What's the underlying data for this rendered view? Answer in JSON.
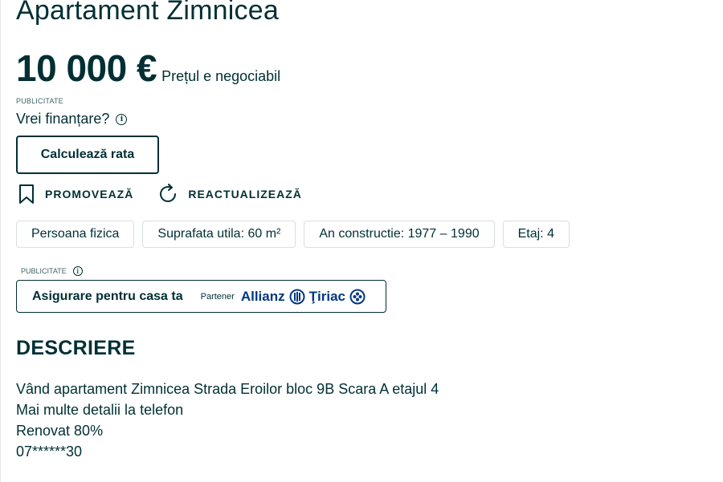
{
  "listing": {
    "title": "Apartament Zimnicea",
    "price": "10 000 €",
    "negotiable": "Prețul e negociabil"
  },
  "financing": {
    "ad_label": "PUBLICITATE",
    "question": "Vrei finanțare?",
    "calc_button": "Calculează rata"
  },
  "actions": {
    "promote": "PROMOVEAZĂ",
    "refresh": "REACTUALIZEAZĂ"
  },
  "attributes": [
    "Persoana fizica",
    "Suprafata utila: 60 m²",
    "An constructie: 1977 – 1990",
    "Etaj: 4"
  ],
  "insurance": {
    "ad_label": "PUBLICITATE",
    "text": "Asigurare pentru casa ta",
    "partner_label": "Partener",
    "brand_part1": "Allianz",
    "brand_part2": "Ţiriac"
  },
  "description": {
    "heading": "DESCRIERE",
    "lines": [
      "Vând apartament Zimnicea Strada Eroilor bloc 9B Scara A etajul 4",
      "Mai multe detalii la telefon",
      "Renovat 80%",
      "07******30"
    ]
  },
  "colors": {
    "text": "#002f34",
    "brand": "#003781",
    "chip_border": "#d8dfe0"
  }
}
